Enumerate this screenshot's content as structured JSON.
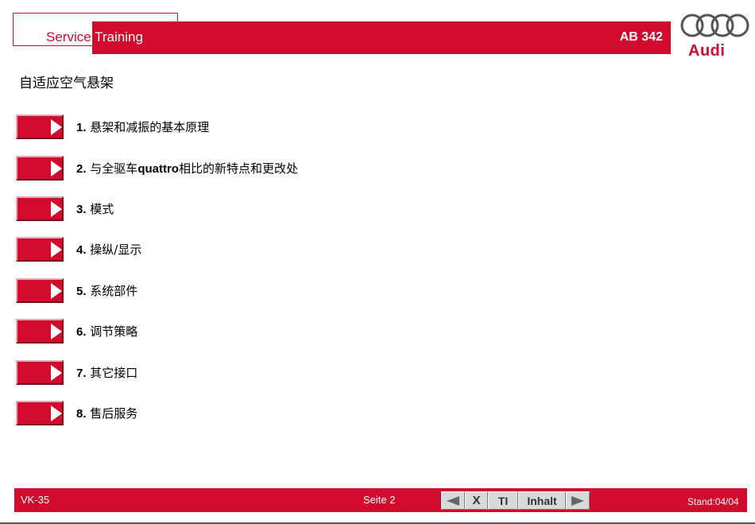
{
  "header": {
    "service_word": "Service",
    "training_word": "Training",
    "doc_code": "AB 342",
    "brand_text": "Audi"
  },
  "page_title": "自适应空气悬架",
  "menu": {
    "items": [
      {
        "number": "1.",
        "text": "悬架和减振的基本原理"
      },
      {
        "number": "2.",
        "text_pre": "与全驱车",
        "text_bold": "quattro",
        "text_post": "相比的新特点和更改处"
      },
      {
        "number": "3.",
        "text": "模式"
      },
      {
        "number": "4.",
        "text": "操纵/显示"
      },
      {
        "number": "5.",
        "text": "系统部件"
      },
      {
        "number": "6.",
        "text": "调节策略"
      },
      {
        "number": "7.",
        "text": "其它接口"
      },
      {
        "number": "8.",
        "text": "售后服务"
      }
    ]
  },
  "footer": {
    "left_code": "VK-35",
    "page_label": "Seite 2",
    "nav": {
      "prev_icon": "arrow-left-icon",
      "close_label": "X",
      "ti_label": "TI",
      "inhalt_label": "Inhalt",
      "next_icon": "arrow-right-icon"
    },
    "stand": "Stand:04/04"
  },
  "colors": {
    "brand_red": "#d20a2e",
    "nav_gray": "#d9d9d9"
  }
}
